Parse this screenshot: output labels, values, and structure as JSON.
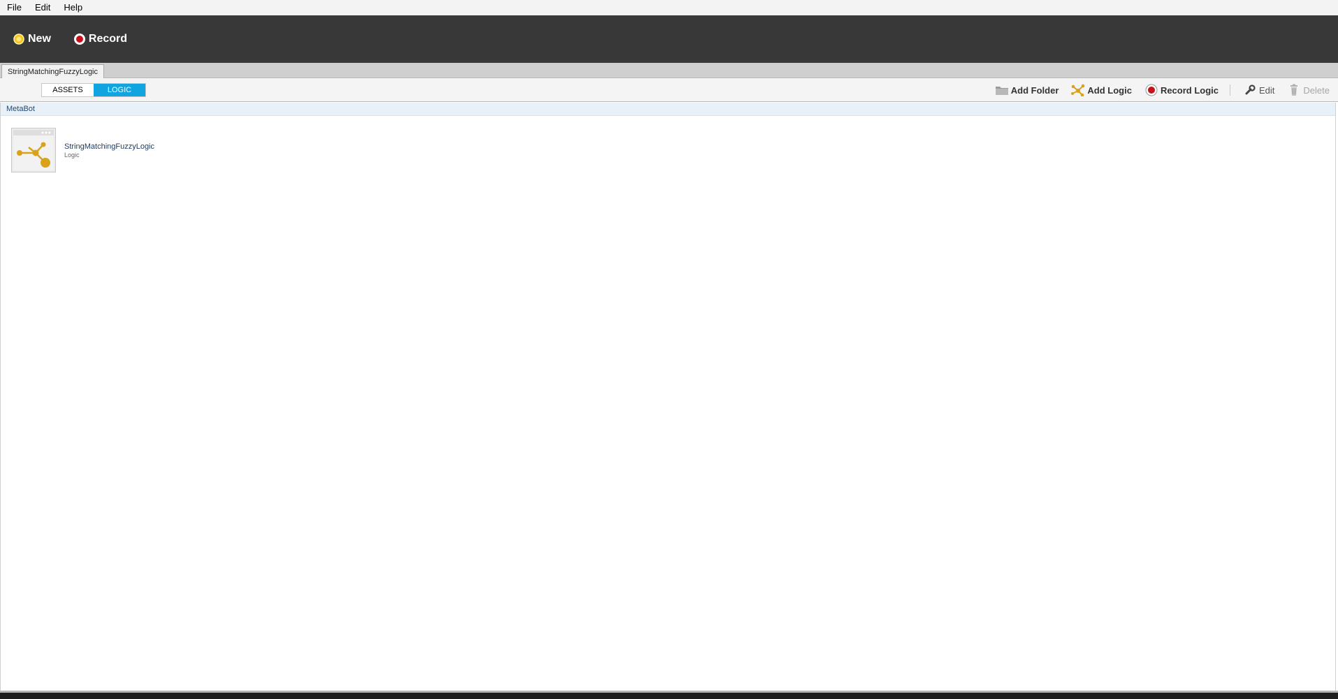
{
  "menu": [
    "File",
    "Edit",
    "Help"
  ],
  "toolbar": {
    "new_label": "New",
    "record_label": "Record"
  },
  "tabs": {
    "active_tab": "StringMatchingFuzzyLogic"
  },
  "view_toggle": {
    "assets_label": "ASSETS",
    "logic_label": "LOGIC",
    "selected": "LOGIC"
  },
  "actions": {
    "add_folder": "Add Folder",
    "add_logic": "Add Logic",
    "record_logic": "Record Logic",
    "edit": "Edit",
    "delete": "Delete"
  },
  "breadcrumb": "MetaBot",
  "items": [
    {
      "name": "StringMatchingFuzzyLogic",
      "type": "Logic"
    }
  ],
  "colors": {
    "accent": "#10a5e0",
    "logic_icon": "#d9a21b",
    "toolbar_bg": "#383838"
  }
}
